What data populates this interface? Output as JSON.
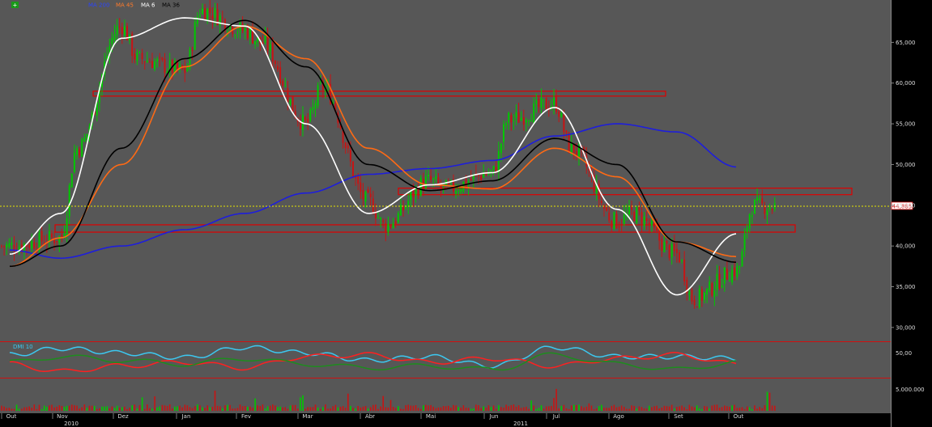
{
  "chart_data": {
    "type": "candlestick",
    "title": "",
    "price_axis": {
      "ylim": [
        28500,
        70000
      ],
      "ticks": [
        {
          "value": 30000,
          "label": "30,000"
        },
        {
          "value": 35000,
          "label": "35,000"
        },
        {
          "value": 40000,
          "label": "40,000"
        },
        {
          "value": 45000,
          "label": "45,000"
        },
        {
          "value": 50000,
          "label": "50,000"
        },
        {
          "value": 55000,
          "label": "55,000"
        },
        {
          "value": 60000,
          "label": "60,000"
        },
        {
          "value": 65000,
          "label": "65,000"
        }
      ],
      "last_price": {
        "value": 44885,
        "label": "44,885"
      }
    },
    "x_axis": {
      "months": [
        "Out",
        "Nov",
        "Dez",
        "Jan",
        "Fev",
        "Mar",
        "Abr",
        "Mai",
        "Jun",
        "Jul",
        "Ago",
        "Set",
        "Out"
      ],
      "years": [
        "2010",
        "2011"
      ]
    },
    "legend": {
      "series_labels": [
        "MA 200",
        "MA 45",
        "MA 6",
        "MA 36"
      ],
      "indicator_label": "DMI 10",
      "volume_label": ""
    },
    "indicator_axis": {
      "ticks": [
        {
          "value": 50,
          "label": "50,00"
        }
      ]
    },
    "volume_axis": {
      "ticks": [
        {
          "value": 5000000,
          "label": "5.000.000"
        }
      ]
    },
    "support_resistance_zones": [
      {
        "from_month": "Nov",
        "to_month": "Jul",
        "low": 58400,
        "high": 59000
      },
      {
        "from_month": "Abr",
        "to_month": "Out",
        "low": 46300,
        "high": 47100
      },
      {
        "from_month": "Out",
        "to_month": "Out",
        "low": 41700,
        "high": 42600
      }
    ],
    "close_series": [
      {
        "x": "Out",
        "y": 40000
      },
      {
        "x": "Nov",
        "y": 41000
      },
      {
        "x": "Nov",
        "y": 52000
      },
      {
        "x": "Dez",
        "y": 67000
      },
      {
        "x": "Dez",
        "y": 63000
      },
      {
        "x": "Jan",
        "y": 61500
      },
      {
        "x": "Jan",
        "y": 69000
      },
      {
        "x": "Fev",
        "y": 66500
      },
      {
        "x": "Fev",
        "y": 65000
      },
      {
        "x": "Mar",
        "y": 55000
      },
      {
        "x": "Mar",
        "y": 59500
      },
      {
        "x": "Abr",
        "y": 45500
      },
      {
        "x": "Abr",
        "y": 42500
      },
      {
        "x": "Mai",
        "y": 48000
      },
      {
        "x": "Mai",
        "y": 47000
      },
      {
        "x": "Jun",
        "y": 49000
      },
      {
        "x": "Jun",
        "y": 55500
      },
      {
        "x": "Jul",
        "y": 57500
      },
      {
        "x": "Jul",
        "y": 52000
      },
      {
        "x": "Ago",
        "y": 43000
      },
      {
        "x": "Ago",
        "y": 44000
      },
      {
        "x": "Set",
        "y": 39000
      },
      {
        "x": "Set",
        "y": 33500
      },
      {
        "x": "Out",
        "y": 37000
      },
      {
        "x": "Out",
        "y": 44885
      }
    ],
    "series": [
      {
        "name": "MA 200",
        "color": "#1e1edc",
        "points": [
          {
            "x": "Out",
            "y": 39500
          },
          {
            "x": "Nov",
            "y": 38500
          },
          {
            "x": "Dez",
            "y": 40000
          },
          {
            "x": "Jan",
            "y": 42000
          },
          {
            "x": "Fev",
            "y": 44000
          },
          {
            "x": "Mar",
            "y": 46500
          },
          {
            "x": "Abr",
            "y": 48800
          },
          {
            "x": "Mai",
            "y": 49500
          },
          {
            "x": "Jun",
            "y": 50500
          },
          {
            "x": "Jul",
            "y": 53500
          },
          {
            "x": "Ago",
            "y": 55000
          },
          {
            "x": "Set",
            "y": 54000
          },
          {
            "x": "Out",
            "y": 49700
          }
        ]
      },
      {
        "name": "MA 45",
        "color": "#ff6a14",
        "points": [
          {
            "x": "Out",
            "y": 37500
          },
          {
            "x": "Nov",
            "y": 41000
          },
          {
            "x": "Dez",
            "y": 50000
          },
          {
            "x": "Jan",
            "y": 62000
          },
          {
            "x": "Fev",
            "y": 67000
          },
          {
            "x": "Mar",
            "y": 63000
          },
          {
            "x": "Abr",
            "y": 52000
          },
          {
            "x": "Mai",
            "y": 47500
          },
          {
            "x": "Jun",
            "y": 47000
          },
          {
            "x": "Jul",
            "y": 52000
          },
          {
            "x": "Ago",
            "y": 48500
          },
          {
            "x": "Set",
            "y": 40500
          },
          {
            "x": "Out",
            "y": 38700
          }
        ]
      },
      {
        "name": "MA 6",
        "color": "#ffffff",
        "points": [
          {
            "x": "Out",
            "y": 39000
          },
          {
            "x": "Nov",
            "y": 44000
          },
          {
            "x": "Dez",
            "y": 65500
          },
          {
            "x": "Jan",
            "y": 68000
          },
          {
            "x": "Fev",
            "y": 67000
          },
          {
            "x": "Mar",
            "y": 55000
          },
          {
            "x": "Abr",
            "y": 44000
          },
          {
            "x": "Mai",
            "y": 47500
          },
          {
            "x": "Jun",
            "y": 49000
          },
          {
            "x": "Jul",
            "y": 57000
          },
          {
            "x": "Ago",
            "y": 44500
          },
          {
            "x": "Set",
            "y": 34000
          },
          {
            "x": "Out",
            "y": 41500
          }
        ]
      },
      {
        "name": "MA 36",
        "color": "#000000",
        "points": [
          {
            "x": "Out",
            "y": 37500
          },
          {
            "x": "Nov",
            "y": 40000
          },
          {
            "x": "Dez",
            "y": 52000
          },
          {
            "x": "Jan",
            "y": 63000
          },
          {
            "x": "Fev",
            "y": 67700
          },
          {
            "x": "Mar",
            "y": 62000
          },
          {
            "x": "Abr",
            "y": 50000
          },
          {
            "x": "Mai",
            "y": 46800
          },
          {
            "x": "Jun",
            "y": 48000
          },
          {
            "x": "Jul",
            "y": 53200
          },
          {
            "x": "Ago",
            "y": 50000
          },
          {
            "x": "Set",
            "y": 40500
          },
          {
            "x": "Out",
            "y": 38000
          }
        ]
      }
    ],
    "indicator_series": [
      {
        "name": "",
        "color": "#3cc8f0",
        "points": [
          {
            "x": "Out",
            "y": 48
          },
          {
            "x": "Nov",
            "y": 55
          },
          {
            "x": "Dez",
            "y": 50
          },
          {
            "x": "Jan",
            "y": 45
          },
          {
            "x": "Fev",
            "y": 56
          },
          {
            "x": "Mar",
            "y": 50
          },
          {
            "x": "Abr",
            "y": 42
          },
          {
            "x": "Mai",
            "y": 46
          },
          {
            "x": "Jun",
            "y": 36
          },
          {
            "x": "Jul",
            "y": 56
          },
          {
            "x": "Ago",
            "y": 46
          },
          {
            "x": "Set",
            "y": 46
          },
          {
            "x": "Out",
            "y": 44
          }
        ]
      },
      {
        "name": "",
        "color": "#ff2020",
        "points": [
          {
            "x": "Out",
            "y": 38
          },
          {
            "x": "Nov",
            "y": 30
          },
          {
            "x": "Dez",
            "y": 36
          },
          {
            "x": "Jan",
            "y": 40
          },
          {
            "x": "Fev",
            "y": 34
          },
          {
            "x": "Mar",
            "y": 46
          },
          {
            "x": "Abr",
            "y": 48
          },
          {
            "x": "Mai",
            "y": 40
          },
          {
            "x": "Jun",
            "y": 44
          },
          {
            "x": "Jul",
            "y": 36
          },
          {
            "x": "Ago",
            "y": 44
          },
          {
            "x": "Set",
            "y": 48
          },
          {
            "x": "Out",
            "y": 38
          }
        ]
      },
      {
        "name": "",
        "color": "#1e8c1e",
        "points": [
          {
            "x": "Out",
            "y": 40
          },
          {
            "x": "Nov",
            "y": 46
          },
          {
            "x": "Dez",
            "y": 42
          },
          {
            "x": "Jan",
            "y": 38
          },
          {
            "x": "Fev",
            "y": 44
          },
          {
            "x": "Mar",
            "y": 38
          },
          {
            "x": "Abr",
            "y": 34
          },
          {
            "x": "Mai",
            "y": 36
          },
          {
            "x": "Jun",
            "y": 32
          },
          {
            "x": "Jul",
            "y": 48
          },
          {
            "x": "Ago",
            "y": 38
          },
          {
            "x": "Set",
            "y": 32
          },
          {
            "x": "Out",
            "y": 40
          }
        ]
      }
    ],
    "grid": false,
    "colors": {
      "up": "#00c800",
      "down": "#c81414",
      "background": "#575757",
      "zone": "#e00000",
      "last_price_line": "#e6e600"
    }
  }
}
